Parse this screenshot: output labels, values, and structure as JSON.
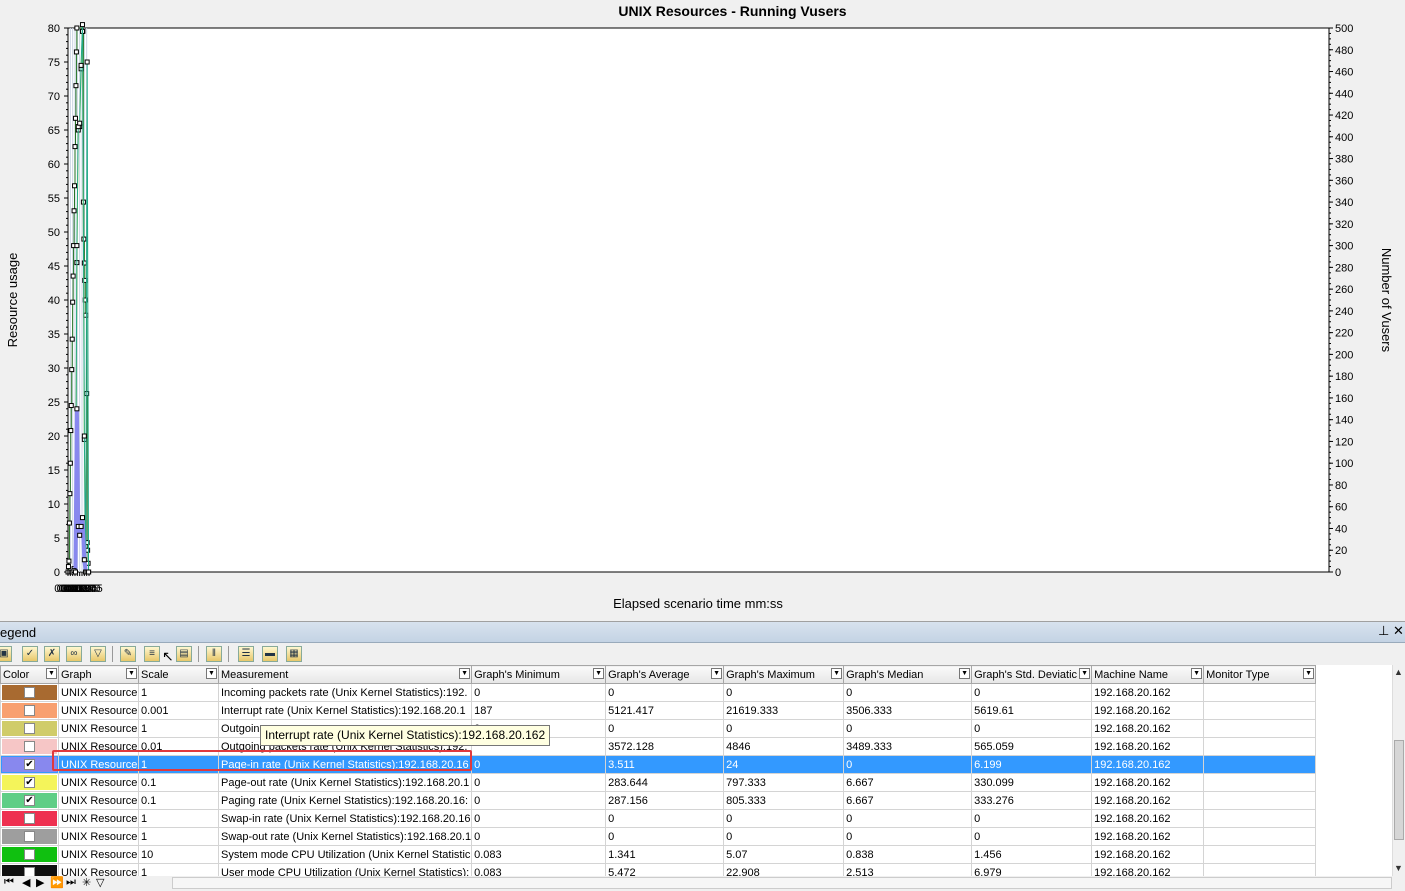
{
  "chart_data": {
    "type": "line",
    "title": "UNIX Resources - Running Vusers",
    "xlabel": "Elapsed scenario time mm:ss",
    "ylabel": "Resource usage",
    "y2label": "Number of Vusers",
    "x_ticks": [
      "00:00",
      "00:05",
      "00:10",
      "00:15",
      "00:20",
      "00:25",
      "00:30",
      "00:35",
      "00:40",
      "00:45"
    ],
    "y_ticks": [
      "0",
      "5",
      "10",
      "15",
      "20",
      "25",
      "30",
      "35",
      "40",
      "45",
      "50",
      "55",
      "60",
      "65",
      "70",
      "75",
      "80"
    ],
    "y2_ticks": [
      "0",
      "20",
      "40",
      "60",
      "80",
      "100",
      "120",
      "140",
      "160",
      "180",
      "200",
      "220",
      "240",
      "260",
      "280",
      "300",
      "320",
      "340",
      "360",
      "380",
      "400",
      "420",
      "440",
      "460",
      "480",
      "500"
    ],
    "ylim": [
      0,
      80
    ],
    "y2lim": [
      0,
      500
    ],
    "xlim_seconds": [
      0,
      2700
    ],
    "grid": "vertical",
    "series": [
      {
        "name": "Running Vusers",
        "axis": "right",
        "step": true,
        "color": "#1e6e1e",
        "x": [
          "00:00",
          "00:01",
          "00:02",
          "00:03",
          "00:04",
          "00:05",
          "00:06",
          "00:07",
          "00:08",
          "00:09",
          "00:10",
          "00:11",
          "00:12",
          "00:13",
          "00:14",
          "00:15",
          "00:16",
          "00:17",
          "00:18",
          "00:19",
          "00:32",
          "00:33",
          "00:34",
          "00:35",
          "00:36",
          "00:37",
          "00:38",
          "00:40",
          "00:41",
          "00:42",
          "00:43",
          "00:44"
        ],
        "values": [
          0,
          5,
          10,
          45,
          72,
          100,
          130,
          153,
          186,
          214,
          248,
          272,
          300,
          332,
          355,
          391,
          417,
          447,
          478,
          500,
          497,
          340,
          306,
          284,
          268,
          250,
          236,
          164,
          27,
          20,
          8,
          0
        ]
      },
      {
        "name": "Page-out rate (Unix Kernel Statistics):192.168.20.162",
        "axis": "left",
        "color": "#e0e040",
        "x": [
          "00:00",
          "00:04",
          "00:07",
          "00:10",
          "00:13",
          "00:16",
          "00:19",
          "00:22",
          "00:25",
          "00:28",
          "00:31",
          "00:35",
          "00:38",
          "00:41",
          "00:44"
        ],
        "values": [
          0,
          0,
          0,
          0,
          0.3,
          0,
          45.5,
          65,
          65.5,
          74,
          79.5,
          19.5,
          0,
          0,
          0
        ]
      },
      {
        "name": "Paging rate (Unix Kernel Statistics):192.168.20.162",
        "axis": "left",
        "color": "#22aa88",
        "x": [
          "00:00",
          "00:04",
          "00:07",
          "00:10",
          "00:13",
          "00:16",
          "00:19",
          "00:22",
          "00:25",
          "00:28",
          "00:31",
          "00:35",
          "00:38",
          "00:41",
          "00:44"
        ],
        "values": [
          0,
          0,
          0,
          0,
          0.5,
          0,
          48,
          65.5,
          66,
          74.5,
          80.5,
          20,
          0,
          75,
          0
        ]
      },
      {
        "name": "Page-in rate (Unix Kernel Statistics):192.168.20.162",
        "axis": "left",
        "color": "#8888ee",
        "x": [
          "00:00",
          "00:04",
          "00:07",
          "00:10",
          "00:13",
          "00:16",
          "00:19",
          "00:22",
          "00:25",
          "00:28",
          "00:31",
          "00:35",
          "00:38",
          "00:41",
          "00:44"
        ],
        "values": [
          0,
          0,
          0,
          0,
          0.2,
          0,
          24,
          6.7,
          5.4,
          6.7,
          8,
          1.8,
          0,
          0,
          0
        ]
      }
    ]
  },
  "legend": {
    "title": "egend",
    "pin_icon": "pin-icon",
    "close_icon": "close-icon",
    "columns": [
      "Color",
      "Graph",
      "Scale",
      "Measurement",
      "Graph's Minimum",
      "Graph's Average",
      "Graph's Maximum",
      "Graph's Median",
      "Graph's Std. Deviatic",
      "Machine Name",
      "Monitor Type"
    ],
    "rows": [
      {
        "color": "#a86a30",
        "checked": false,
        "graph": "UNIX Resource",
        "scale": "1",
        "measurement": "Incoming packets rate (Unix Kernel Statistics):192.",
        "min": "0",
        "avg": "0",
        "max": "0",
        "median": "0",
        "std": "0",
        "machine": "192.168.20.162",
        "monitor": "",
        "selected": false
      },
      {
        "color": "#f8a070",
        "checked": false,
        "graph": "UNIX Resource",
        "scale": "0.001",
        "measurement": "Interrupt rate (Unix Kernel Statistics):192.168.20.1",
        "min": "187",
        "avg": "5121.417",
        "max": "21619.333",
        "median": "3506.333",
        "std": "5619.61",
        "machine": "192.168.20.162",
        "monitor": "",
        "selected": false
      },
      {
        "color": "#d0cc6a",
        "checked": false,
        "graph": "UNIX Resource",
        "scale": "1",
        "measurement": "Outgoing",
        "min": "0",
        "avg": "0",
        "max": "0",
        "median": "0",
        "std": "0",
        "machine": "192.168.20.162",
        "monitor": "",
        "selected": false
      },
      {
        "color": "#f6c6c6",
        "checked": false,
        "graph": "UNIX Resource",
        "scale": "0.01",
        "measurement": "Outgoing packets rate (Unix Kernel Statistics):192.",
        "min": "",
        "avg": "3572.128",
        "max": "4846",
        "median": "3489.333",
        "std": "565.059",
        "machine": "192.168.20.162",
        "monitor": "",
        "selected": false
      },
      {
        "color": "#8888ee",
        "checked": true,
        "graph": "UNIX Resource",
        "scale": "1",
        "measurement": "Page-in rate (Unix Kernel Statistics):192.168.20.16",
        "min": "0",
        "avg": "3.511",
        "max": "24",
        "median": "0",
        "std": "6.199",
        "machine": "192.168.20.162",
        "monitor": "",
        "selected": true
      },
      {
        "color": "#f4f45a",
        "checked": true,
        "graph": "UNIX Resource",
        "scale": "0.1",
        "measurement": "Page-out rate (Unix Kernel Statistics):192.168.20.1",
        "min": "0",
        "avg": "283.644",
        "max": "797.333",
        "median": "6.667",
        "std": "330.099",
        "machine": "192.168.20.162",
        "monitor": "",
        "selected": false
      },
      {
        "color": "#5fce86",
        "checked": true,
        "graph": "UNIX Resource",
        "scale": "0.1",
        "measurement": "Paging rate (Unix Kernel Statistics):192.168.20.16:",
        "min": "0",
        "avg": "287.156",
        "max": "805.333",
        "median": "6.667",
        "std": "333.276",
        "machine": "192.168.20.162",
        "monitor": "",
        "selected": false
      },
      {
        "color": "#ee3050",
        "checked": false,
        "graph": "UNIX Resource",
        "scale": "1",
        "measurement": "Swap-in rate (Unix Kernel Statistics):192.168.20.16",
        "min": "0",
        "avg": "0",
        "max": "0",
        "median": "0",
        "std": "0",
        "machine": "192.168.20.162",
        "monitor": "",
        "selected": false
      },
      {
        "color": "#9e9e9e",
        "checked": false,
        "graph": "UNIX Resource",
        "scale": "1",
        "measurement": "Swap-out rate (Unix Kernel Statistics):192.168.20.1",
        "min": "0",
        "avg": "0",
        "max": "0",
        "median": "0",
        "std": "0",
        "machine": "192.168.20.162",
        "monitor": "",
        "selected": false
      },
      {
        "color": "#10c010",
        "checked": false,
        "graph": "UNIX Resource",
        "scale": "10",
        "measurement": "System mode CPU Utilization (Unix Kernel Statistic",
        "min": "0.083",
        "avg": "1.341",
        "max": "5.07",
        "median": "0.838",
        "std": "1.456",
        "machine": "192.168.20.162",
        "monitor": "",
        "selected": false
      },
      {
        "color": "#101010",
        "checked": false,
        "graph": "UNIX Resource",
        "scale": "1",
        "measurement": "User mode CPU Utilization (Unix Kernel Statistics):",
        "min": "0.083",
        "avg": "5.472",
        "max": "22.908",
        "median": "2.513",
        "std": "6.979",
        "machine": "192.168.20.162",
        "monitor": "",
        "selected": false
      }
    ],
    "tooltip": "Interrupt rate (Unix Kernel Statistics):192.168.20.162"
  }
}
